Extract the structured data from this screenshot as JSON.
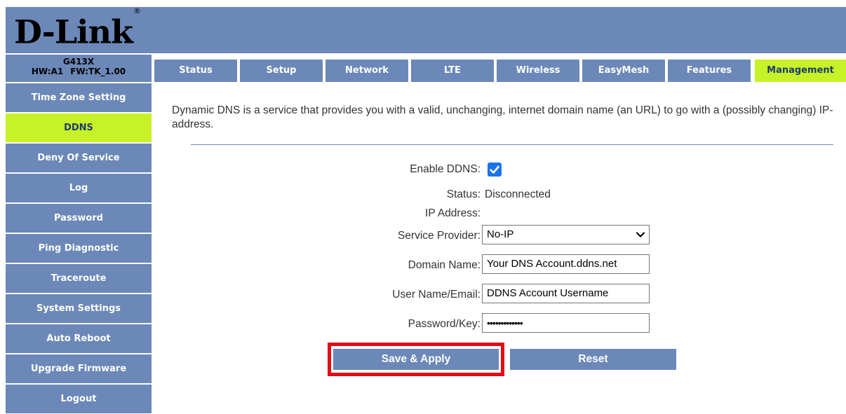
{
  "header": {
    "logo_text": "D-Link",
    "logo_mark": "®"
  },
  "device": {
    "model": "G413X",
    "hw": "HW:A1",
    "fw": "FW:TK_1.00"
  },
  "tabs": [
    {
      "label": "Status",
      "active": false
    },
    {
      "label": "Setup",
      "active": false
    },
    {
      "label": "Network",
      "active": false
    },
    {
      "label": "LTE",
      "active": false
    },
    {
      "label": "Wireless",
      "active": false
    },
    {
      "label": "EasyMesh",
      "active": false
    },
    {
      "label": "Features",
      "active": false
    },
    {
      "label": "Management",
      "active": true
    }
  ],
  "sidebar": {
    "items": [
      {
        "label": "Time Zone Setting",
        "active": false
      },
      {
        "label": "DDNS",
        "active": true
      },
      {
        "label": "Deny Of Service",
        "active": false
      },
      {
        "label": "Log",
        "active": false
      },
      {
        "label": "Password",
        "active": false
      },
      {
        "label": "Ping Diagnostic",
        "active": false
      },
      {
        "label": "Traceroute",
        "active": false
      },
      {
        "label": "System Settings",
        "active": false
      },
      {
        "label": "Auto Reboot",
        "active": false
      },
      {
        "label": "Upgrade Firmware",
        "active": false
      },
      {
        "label": "Logout",
        "active": false
      }
    ]
  },
  "main": {
    "intro": "Dynamic DNS is a service that provides you with a valid, unchanging, internet domain name (an URL) to go with a (possibly changing) IP-address.",
    "form": {
      "enable_label": "Enable DDNS:",
      "enable_checked": true,
      "status_label": "Status:",
      "status_value": "Disconnected",
      "ip_label": "IP Address:",
      "ip_value": "",
      "provider_label": "Service Provider:",
      "provider_value": "No-IP",
      "domain_label": "Domain Name:",
      "domain_value": "Your DNS Account.ddns.net",
      "user_label": "User Name/Email:",
      "user_value": "DDNS Account Username",
      "password_label": "Password/Key:",
      "password_value": "•••••••••••••"
    },
    "buttons": {
      "save_label": "Save & Apply",
      "reset_label": "Reset"
    }
  },
  "colors": {
    "nav_blue": "#6b88b8",
    "active_green": "#c7f227",
    "active_text": "#1d3b72",
    "highlight_red": "#e50914",
    "checkbox_blue": "#1a73e8"
  },
  "icons": {
    "checkbox": "checkmark-icon",
    "dropdown": "chevron-down-icon"
  }
}
